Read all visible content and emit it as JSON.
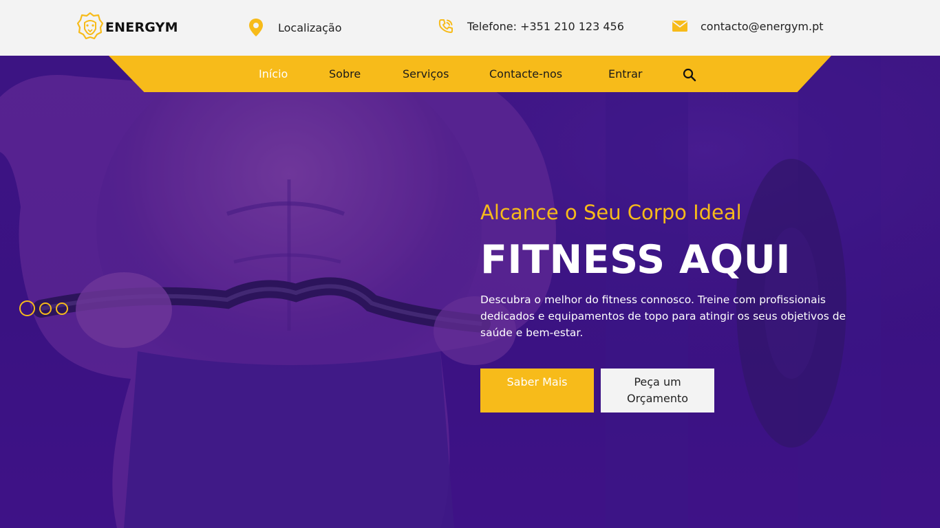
{
  "brand": {
    "name": "ENERGYM"
  },
  "header": {
    "location": "Localização",
    "phone": "Telefone: +351 210 123 456",
    "email": "contacto@energym.pt"
  },
  "nav": {
    "items": [
      "Início",
      "Sobre",
      "Serviços",
      "Contacte-nos",
      "Entrar"
    ],
    "active": "Início"
  },
  "hero": {
    "subtitle": "Alcance o Seu Corpo Ideal",
    "title": "FITNESS AQUI",
    "description": "Descubra o melhor do fitness connosco. Treine com profissionais dedicados e equipamentos de topo para atingir os seus objetivos de saúde e bem-estar.",
    "primary_button": "Saber Mais",
    "secondary_button": "Peça um Orçamento"
  },
  "slider": {
    "slides": 3,
    "active_index": 0
  },
  "icons": {
    "logo": "lion-icon",
    "location": "map-pin-icon",
    "phone": "phone-icon",
    "email": "envelope-icon",
    "search": "search-icon"
  },
  "colors": {
    "accent": "#f7bb1a",
    "hero_overlay": "#3b1580",
    "topbar": "#f3f3f3"
  }
}
